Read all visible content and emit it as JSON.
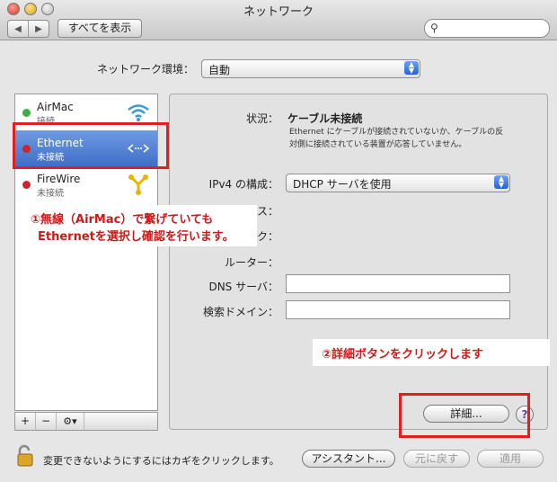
{
  "window": {
    "title": "ネットワーク"
  },
  "toolbar": {
    "back_icon": "◀",
    "forward_icon": "▶",
    "show_all_label": "すべてを表示",
    "search_placeholder": "",
    "search_icon": "🔍"
  },
  "location": {
    "label": "ネットワーク環境：",
    "value": "自動"
  },
  "services": [
    {
      "name": "AirMac",
      "status": "接続",
      "dot_color": "#3cb043"
    },
    {
      "name": "Ethernet",
      "status": "未接続",
      "dot_color": "#d2232a"
    },
    {
      "name": "FireWire",
      "status": "未接続",
      "dot_color": "#d2232a"
    }
  ],
  "list_controls": {
    "add": "+",
    "remove": "−",
    "action": "⚙▾"
  },
  "detail": {
    "status_label": "状況：",
    "status_value": "ケーブル未接続",
    "status_desc_1": "Ethernet にケーブルが接続されていないか、ケーブルの反",
    "status_desc_2": "対側に接続されている装置が応答していません。",
    "ipv4_label": "IPv4 の構成：",
    "ipv4_value": "DHCP サーバを使用",
    "ip_label_tail": "ス：",
    "mask_label_tail": "ク：",
    "router_label": "ルーター：",
    "dns_label": "DNS サーバ：",
    "search_domain_label": "検索ドメイン：",
    "dns_value": "",
    "search_domain_value": ""
  },
  "buttons": {
    "advanced": "詳細...",
    "help": "?",
    "assistant": "アシスタント...",
    "revert": "元に戻す",
    "apply": "適用"
  },
  "lock_text": "変更できないようにするにはカギをクリックします。",
  "annotations": {
    "callout1_line1": "①無線（AirMac）で繋げていても",
    "callout1_line2": "Ethernetを選択し確認を行います。",
    "callout2": "②詳細ボタンをクリックします",
    "highlight_color": "#e02020"
  }
}
